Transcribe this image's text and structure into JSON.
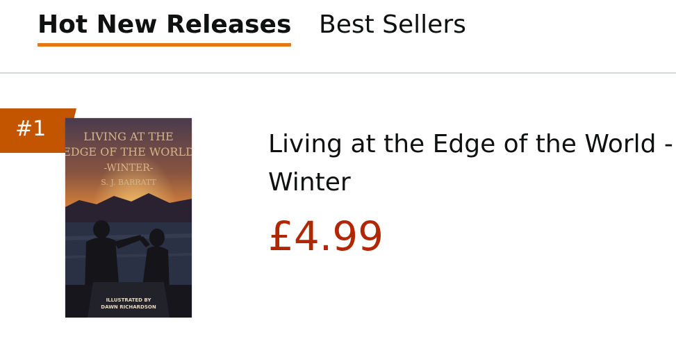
{
  "tabs": [
    {
      "label": "Hot New Releases",
      "active": true
    },
    {
      "label": "Best Sellers",
      "active": false
    }
  ],
  "product": {
    "rank": "#1",
    "title": "Living at the Edge of the World - Winter",
    "price": "£4.99",
    "cover": {
      "title_line1": "LIVING AT THE",
      "title_line2": "EDGE OF THE WORLD",
      "title_line3": "-WINTER-",
      "author": "S. J. BARRATT",
      "credit_line1": "ILLUSTRATED BY",
      "credit_line2": "DAWN RICHARDSON"
    }
  },
  "colors": {
    "accent_underline": "#e47911",
    "rank_badge": "#c45500",
    "price": "#b12704",
    "text": "#0f1111"
  }
}
